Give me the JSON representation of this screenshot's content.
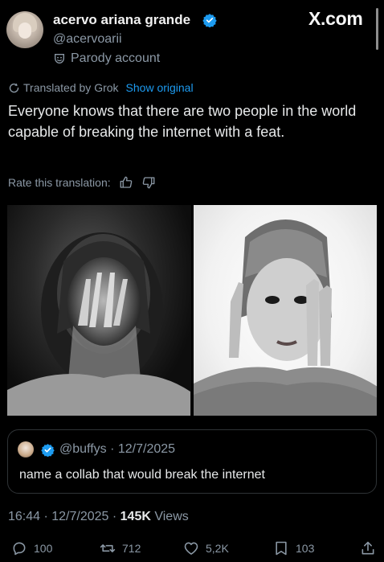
{
  "author": {
    "display_name": "acervo ariana grande",
    "handle": "@acervoarii",
    "parody_label": "Parody account"
  },
  "site_label": "X.com",
  "translation": {
    "label": "Translated by Grok",
    "show_original": "Show original",
    "rate_label": "Rate this translation:"
  },
  "tweet": {
    "text": "Everyone knows that there are two people in the world capable of breaking the internet with a feat."
  },
  "quote": {
    "meta": "@buffys · 12/7/2025",
    "text": "name a collab that would break the internet"
  },
  "meta": {
    "time_date": "16:44 · 12/7/2025 · ",
    "views_count": "145K",
    "views_label": " Views"
  },
  "actions": {
    "replies": "100",
    "reposts": "712",
    "likes": "5,2K",
    "bookmarks": "103"
  },
  "colors": {
    "background": "#000000",
    "text": "#e7e9ea",
    "secondary": "#8b98a5",
    "link": "#1d9bf0",
    "verified": "#1d9bf0",
    "border": "#2f3336"
  },
  "icons": [
    "verified-badge-icon",
    "parody-mask-icon",
    "translate-refresh-icon",
    "thumbs-up-icon",
    "thumbs-down-icon",
    "reply-icon",
    "repost-icon",
    "like-icon",
    "bookmark-icon",
    "share-icon"
  ]
}
